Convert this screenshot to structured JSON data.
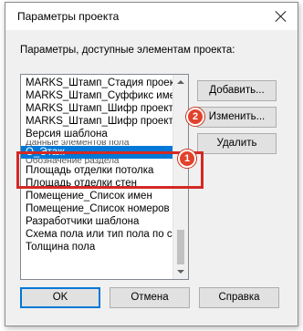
{
  "window": {
    "title": "Параметры проекта"
  },
  "label": "Параметры, доступные элементам проекта:",
  "list": {
    "items": [
      {
        "text": "MARKS_Штамп_Стадия проект",
        "state": "normal"
      },
      {
        "text": "MARKS_Штамп_Суффикс имени",
        "state": "normal"
      },
      {
        "text": "MARKS_Штамп_Шифр проекта",
        "state": "normal"
      },
      {
        "text": "MARKS_Штамп_Шифр проекта",
        "state": "normal"
      },
      {
        "text": "Версия шаблона",
        "state": "normal"
      },
      {
        "text": "Данные элементов пола",
        "state": "clip"
      },
      {
        "text": "О_Этаж",
        "state": "sel"
      },
      {
        "text": "Обозначение раздела",
        "state": "clip"
      },
      {
        "text": "Площадь отделки потолка",
        "state": "normal"
      },
      {
        "text": "Площадь отделки стен",
        "state": "normal"
      },
      {
        "text": "Помещение_Список имен",
        "state": "normal"
      },
      {
        "text": "Помещение_Список номеров",
        "state": "normal"
      },
      {
        "text": "Разработчики шаблона",
        "state": "normal"
      },
      {
        "text": "Схема пола или тип пола по сери",
        "state": "normal"
      },
      {
        "text": "Толщина пола",
        "state": "normal"
      }
    ]
  },
  "buttons": {
    "add": "Добавить...",
    "modify": "Изменить...",
    "delete": "Удалить",
    "ok": "OK",
    "cancel": "Отмена",
    "help": "Справка"
  },
  "annotations": {
    "badge1": "1",
    "badge2": "2",
    "color": "#e2412b"
  },
  "colors": {
    "selection": "#0078d7",
    "highlight": "#d32a24"
  }
}
